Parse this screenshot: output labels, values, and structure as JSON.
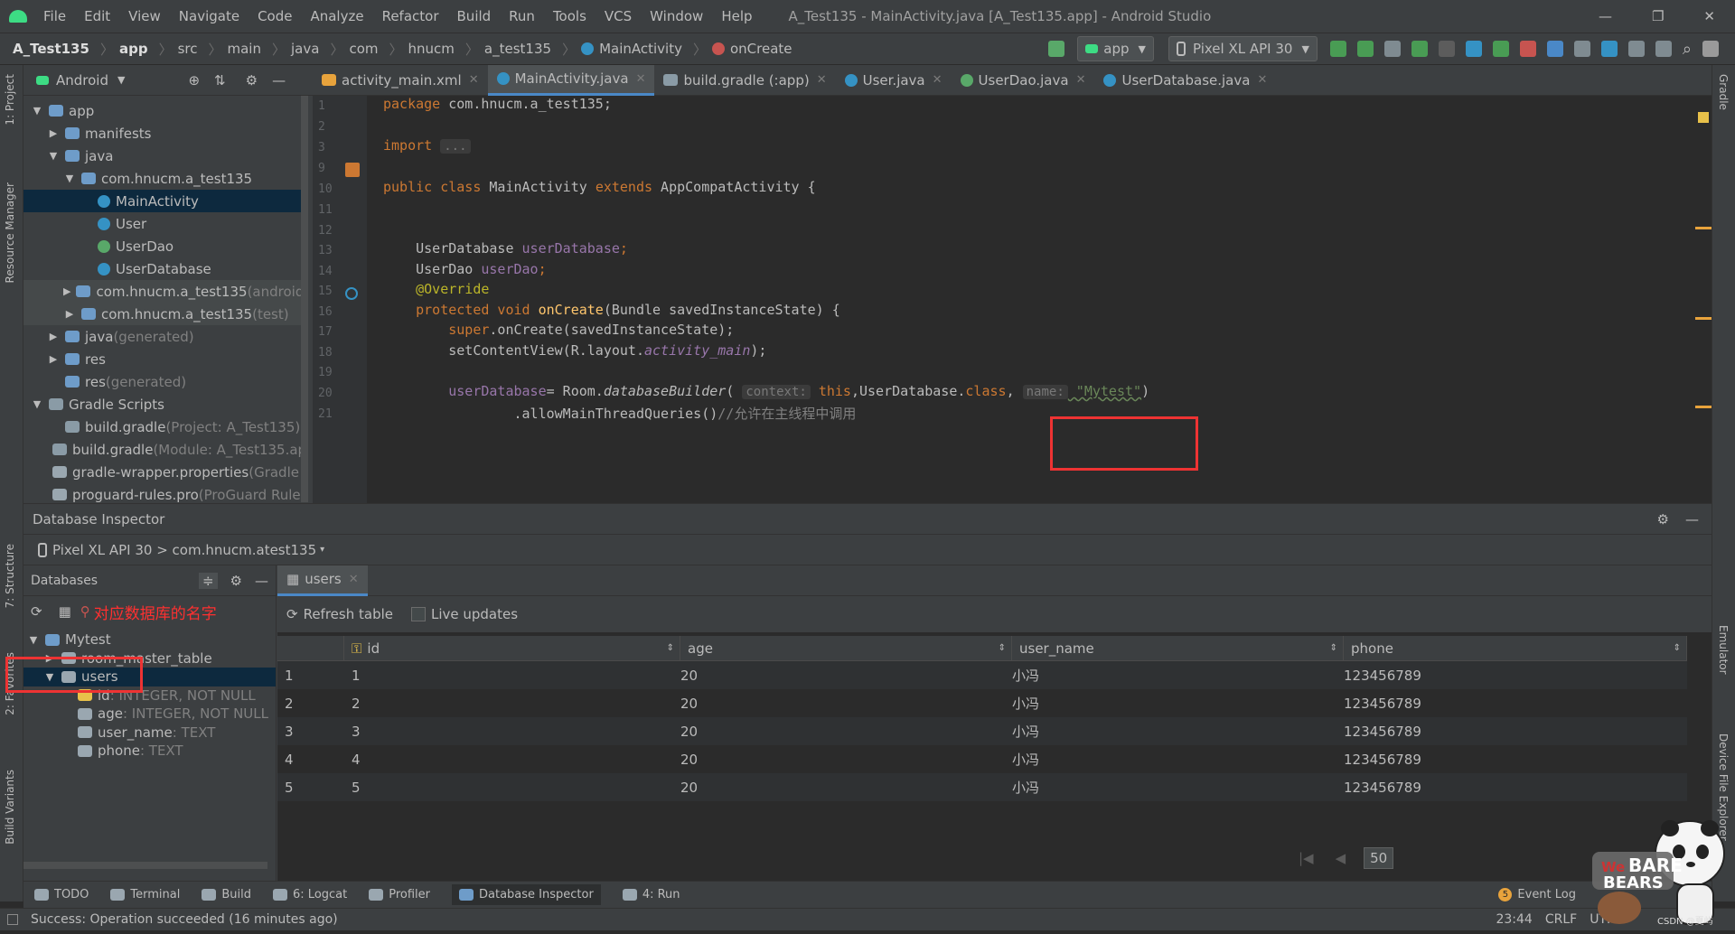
{
  "window": {
    "menu": [
      "File",
      "Edit",
      "View",
      "Navigate",
      "Code",
      "Analyze",
      "Refactor",
      "Build",
      "Run",
      "Tools",
      "VCS",
      "Window",
      "Help"
    ],
    "title": "A_Test135 - MainActivity.java [A_Test135.app] - Android Studio",
    "controls": [
      "—",
      "❐",
      "✕"
    ]
  },
  "breadcrumb": [
    "A_Test135",
    "app",
    "src",
    "main",
    "java",
    "com",
    "hnucm",
    "a_test135",
    "MainActivity",
    "onCreate"
  ],
  "toolbar": {
    "run_config": "app",
    "device": "Pixel XL API 30"
  },
  "project": {
    "view_label": "Android",
    "tree": [
      {
        "label": "app",
        "suffix": "",
        "indent": 0,
        "arrow": "▼",
        "icon": "folder"
      },
      {
        "label": "manifests",
        "suffix": "",
        "indent": 1,
        "arrow": "▶",
        "icon": "folder"
      },
      {
        "label": "java",
        "suffix": "",
        "indent": 1,
        "arrow": "▼",
        "icon": "folder"
      },
      {
        "label": "com.hnucm.a_test135",
        "suffix": "",
        "indent": 2,
        "arrow": "▼",
        "icon": "package"
      },
      {
        "label": "MainActivity",
        "suffix": "",
        "indent": 3,
        "arrow": "",
        "icon": "class",
        "selected": true
      },
      {
        "label": "User",
        "suffix": "",
        "indent": 3,
        "arrow": "",
        "icon": "class"
      },
      {
        "label": "UserDao",
        "suffix": "",
        "indent": 3,
        "arrow": "",
        "icon": "interface"
      },
      {
        "label": "UserDatabase",
        "suffix": "",
        "indent": 3,
        "arrow": "",
        "icon": "abstract"
      },
      {
        "label": "com.hnucm.a_test135",
        "suffix": " (androidTest)",
        "indent": 2,
        "arrow": "▶",
        "icon": "package",
        "hl": true
      },
      {
        "label": "com.hnucm.a_test135",
        "suffix": " (test)",
        "indent": 2,
        "arrow": "▶",
        "icon": "package",
        "hl": true
      },
      {
        "label": "java",
        "suffix": " (generated)",
        "indent": 1,
        "arrow": "▶",
        "icon": "folder"
      },
      {
        "label": "res",
        "suffix": "",
        "indent": 1,
        "arrow": "▶",
        "icon": "folder"
      },
      {
        "label": "res",
        "suffix": " (generated)",
        "indent": 1,
        "arrow": "",
        "icon": "folder"
      },
      {
        "label": "Gradle Scripts",
        "suffix": "",
        "indent": 0,
        "arrow": "▼",
        "icon": "gradle"
      },
      {
        "label": "build.gradle",
        "suffix": " (Project: A_Test135)",
        "indent": 1,
        "arrow": "",
        "icon": "gradle"
      },
      {
        "label": "build.gradle",
        "suffix": " (Module: A_Test135.app)",
        "indent": 1,
        "arrow": "",
        "icon": "gradle"
      },
      {
        "label": "gradle-wrapper.properties",
        "suffix": " (Gradle Version)",
        "indent": 1,
        "arrow": "",
        "icon": "props"
      },
      {
        "label": "proguard-rules.pro",
        "suffix": " (ProGuard Rules)",
        "indent": 1,
        "arrow": "",
        "icon": "props"
      }
    ]
  },
  "editor_tabs": [
    {
      "label": "activity_main.xml",
      "icon": "xml"
    },
    {
      "label": "MainActivity.java",
      "icon": "class",
      "active": true
    },
    {
      "label": "build.gradle (:app)",
      "icon": "gradle"
    },
    {
      "label": "User.java",
      "icon": "class"
    },
    {
      "label": "UserDao.java",
      "icon": "interface"
    },
    {
      "label": "UserDatabase.java",
      "icon": "abstract"
    }
  ],
  "code": {
    "line_numbers": [
      "1",
      "2",
      "3",
      "9",
      "10",
      "11",
      "12",
      "13",
      "14",
      "15",
      "16",
      "17",
      "18",
      "19",
      "20",
      "21"
    ],
    "package_kw": "package",
    "package_name": " com.hnucm.a_test135;",
    "import_kw": "import",
    "import_fold": "...",
    "l10_a": "public class",
    "l10_b": " MainActivity ",
    "l10_c": "extends",
    "l10_d": " AppCompatActivity {",
    "l13_type": "UserDatabase ",
    "l13_field": "userDatabase",
    "l13_end": ";",
    "l14_type": "UserDao ",
    "l14_field": "userDao",
    "l14_end": ";",
    "l15_ann": "@Override",
    "l16_kw": "protected void ",
    "l16_mth": "onCreate",
    "l16_rest": "(Bundle savedInstanceState) {",
    "l17_kw": "super",
    "l17_rest": ".onCreate(savedInstanceState);",
    "l18_a": "setContentView(R.layout.",
    "l18_b": "activity_main",
    "l18_c": ");",
    "l20_field": "userDatabase",
    "l20_a": "= Room.",
    "l20_mth": "databaseBuilder",
    "l20_b": "( ",
    "l20_hint1": "context:",
    "l20_this": " this",
    "l20_c": ",UserDatabase.",
    "l20_class": "class",
    "l20_d": ", ",
    "l20_hint2": "name:",
    "l20_str": " \"Mytest\"",
    "l20_e": ")",
    "l21_a": "        .allowMainThreadQueries()",
    "l21_cmt": "//允许在主线程中调用"
  },
  "db_inspector": {
    "title": "Database Inspector",
    "device_path": "Pixel XL API 30 > com.hnucm.atest135",
    "databases_label": "Databases",
    "annotation": "对应数据库的名字",
    "tree": [
      {
        "label": "Mytest",
        "detail": "",
        "indent": 0,
        "arrow": "▼",
        "icon": "db"
      },
      {
        "label": "room_master_table",
        "detail": "",
        "indent": 1,
        "arrow": "▶",
        "icon": "table"
      },
      {
        "label": "users",
        "detail": "",
        "indent": 1,
        "arrow": "▼",
        "icon": "table",
        "selected": true
      },
      {
        "label": "id",
        "detail": " :  INTEGER, NOT NULL",
        "indent": 2,
        "arrow": "",
        "icon": "key"
      },
      {
        "label": "age",
        "detail": " :  INTEGER, NOT NULL",
        "indent": 2,
        "arrow": "",
        "icon": "col"
      },
      {
        "label": "user_name",
        "detail": " :  TEXT",
        "indent": 2,
        "arrow": "",
        "icon": "col"
      },
      {
        "label": "phone",
        "detail": " :  TEXT",
        "indent": 2,
        "arrow": "",
        "icon": "col"
      }
    ],
    "table_tab": "users",
    "refresh_label": "Refresh table",
    "live_label": "Live updates",
    "columns": [
      "id",
      "age",
      "user_name",
      "phone"
    ],
    "rows": [
      {
        "n": "1",
        "id": "1",
        "age": "20",
        "user_name": "小冯",
        "phone": "123456789"
      },
      {
        "n": "2",
        "id": "2",
        "age": "20",
        "user_name": "小冯",
        "phone": "123456789"
      },
      {
        "n": "3",
        "id": "3",
        "age": "20",
        "user_name": "小冯",
        "phone": "123456789"
      },
      {
        "n": "4",
        "id": "4",
        "age": "20",
        "user_name": "小冯",
        "phone": "123456789"
      },
      {
        "n": "5",
        "id": "5",
        "age": "20",
        "user_name": "小冯",
        "phone": "123456789"
      }
    ],
    "page_size": "50"
  },
  "tool_windows": [
    {
      "label": "TODO",
      "icon": "list"
    },
    {
      "label": "Terminal",
      "icon": "terminal"
    },
    {
      "label": "Build",
      "icon": "hammer"
    },
    {
      "label": "6: Logcat",
      "icon": "logcat"
    },
    {
      "label": "Profiler",
      "icon": "gauge"
    },
    {
      "label": "Database Inspector",
      "icon": "db",
      "active": true
    },
    {
      "label": "4: Run",
      "icon": "play"
    }
  ],
  "event_log": {
    "count": "5",
    "label": "Event Log"
  },
  "side_tabs_left": [
    "1: Project",
    "Resource Manager",
    "7: Structure",
    "2: Favorites",
    "Build Variants"
  ],
  "side_tabs_right": [
    "Gradle",
    "Emulator",
    "Device File Explorer"
  ],
  "status": {
    "message": "Success: Operation succeeded (16 minutes ago)",
    "position": "23:44",
    "line_sep": "CRLF",
    "encoding": "UTF-8"
  },
  "watermark": "CSDN @夏屿"
}
